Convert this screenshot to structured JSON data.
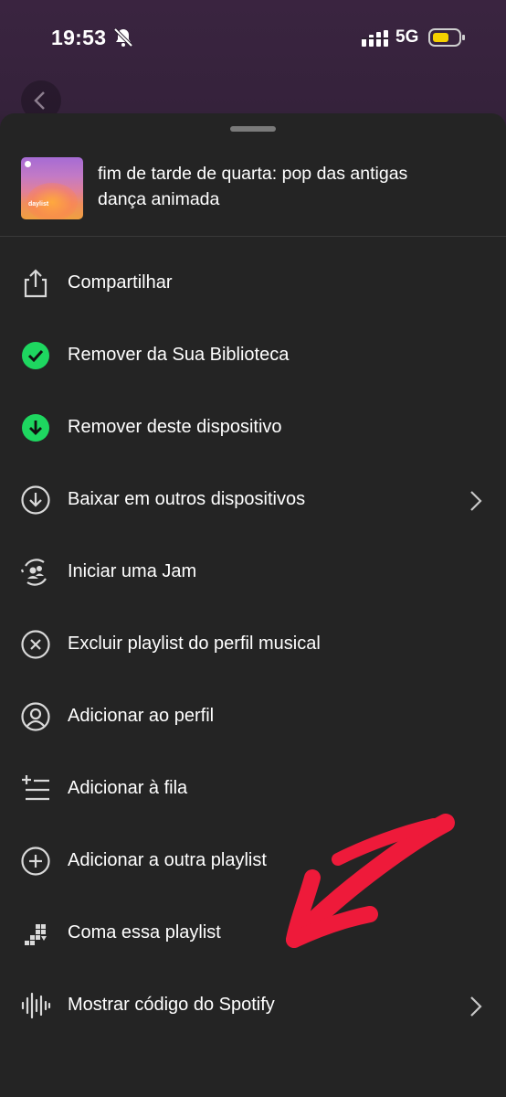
{
  "status_bar": {
    "time": "19:53",
    "network": "5G",
    "icons": [
      "bell-muted-icon",
      "signal-icon",
      "battery-icon"
    ],
    "battery_color": "#f5d000"
  },
  "playlist": {
    "title_line1": "fim de tarde de quarta: pop das antigas",
    "title_line2": "dança animada",
    "cover_label": "daylist"
  },
  "menu": {
    "items": [
      {
        "label": "Compartilhar",
        "icon": "share-icon"
      },
      {
        "label": "Remover da Sua Biblioteca",
        "icon": "check-circle-icon"
      },
      {
        "label": "Remover deste dispositivo",
        "icon": "downloaded-icon"
      },
      {
        "label": "Baixar em outros dispositivos",
        "icon": "download-circle-icon"
      },
      {
        "label": "Iniciar uma Jam",
        "icon": "jam-icon"
      },
      {
        "label": "Excluir playlist do perfil musical",
        "icon": "exclude-icon"
      },
      {
        "label": "Adicionar ao perfil",
        "icon": "profile-icon"
      },
      {
        "label": "Adicionar à fila",
        "icon": "add-to-queue-icon"
      },
      {
        "label": "Adicionar a outra playlist",
        "icon": "add-circle-icon"
      },
      {
        "label": "Coma essa playlist",
        "icon": "blend-icon"
      },
      {
        "label": "Mostrar código do Spotify",
        "icon": "spotify-code-icon"
      }
    ]
  },
  "colors": {
    "sheet_background": "#242424",
    "accent_green": "#1ed760",
    "annotation_red": "#ee1a3a"
  }
}
